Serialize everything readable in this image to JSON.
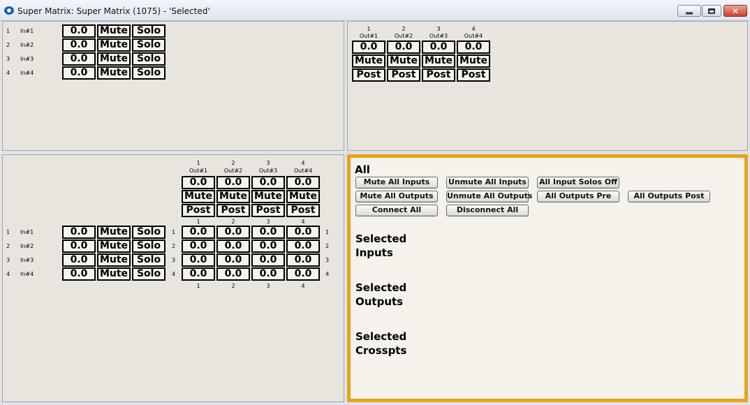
{
  "window": {
    "title": "Super Matrix: Super Matrix (1075) - 'Selected'"
  },
  "inputs": [
    {
      "index": "1",
      "name": "In#1",
      "level": "0.0",
      "mute": "Mute",
      "solo": "Solo"
    },
    {
      "index": "2",
      "name": "In#2",
      "level": "0.0",
      "mute": "Mute",
      "solo": "Solo"
    },
    {
      "index": "3",
      "name": "In#3",
      "level": "0.0",
      "mute": "Mute",
      "solo": "Solo"
    },
    {
      "index": "4",
      "name": "In#4",
      "level": "0.0",
      "mute": "Mute",
      "solo": "Solo"
    }
  ],
  "outputs": [
    {
      "index": "1",
      "name": "Out#1",
      "level": "0.0",
      "mute": "Mute",
      "post": "Post"
    },
    {
      "index": "2",
      "name": "Out#2",
      "level": "0.0",
      "mute": "Mute",
      "post": "Post"
    },
    {
      "index": "3",
      "name": "Out#3",
      "level": "0.0",
      "mute": "Mute",
      "post": "Post"
    },
    {
      "index": "4",
      "name": "Out#4",
      "level": "0.0",
      "mute": "Mute",
      "post": "Post"
    }
  ],
  "crosspoints": [
    [
      "0.0",
      "0.0",
      "0.0",
      "0.0"
    ],
    [
      "0.0",
      "0.0",
      "0.0",
      "0.0"
    ],
    [
      "0.0",
      "0.0",
      "0.0",
      "0.0"
    ],
    [
      "0.0",
      "0.0",
      "0.0",
      "0.0"
    ]
  ],
  "all_panel": {
    "header": "All",
    "buttons": {
      "mute_all_inputs": "Mute All Inputs",
      "unmute_all_inputs": "Unmute All Inputs",
      "all_input_solos_off": "All Input Solos Off",
      "mute_all_outputs": "Mute All Outputs",
      "unmute_all_outputs": "Unmute All Outputs",
      "all_outputs_pre": "All Outputs Pre",
      "all_outputs_post": "All Outputs Post",
      "connect_all": "Connect All",
      "disconnect_all": "Disconnect All"
    },
    "selected_inputs": "Selected\nInputs",
    "selected_outputs": "Selected\nOutputs",
    "selected_crosspts": "Selected\nCrosspts"
  },
  "colors": {
    "accent_border": "#e8a317",
    "pane_bg": "#e8e5df",
    "control_bg": "#f5f2ec"
  }
}
